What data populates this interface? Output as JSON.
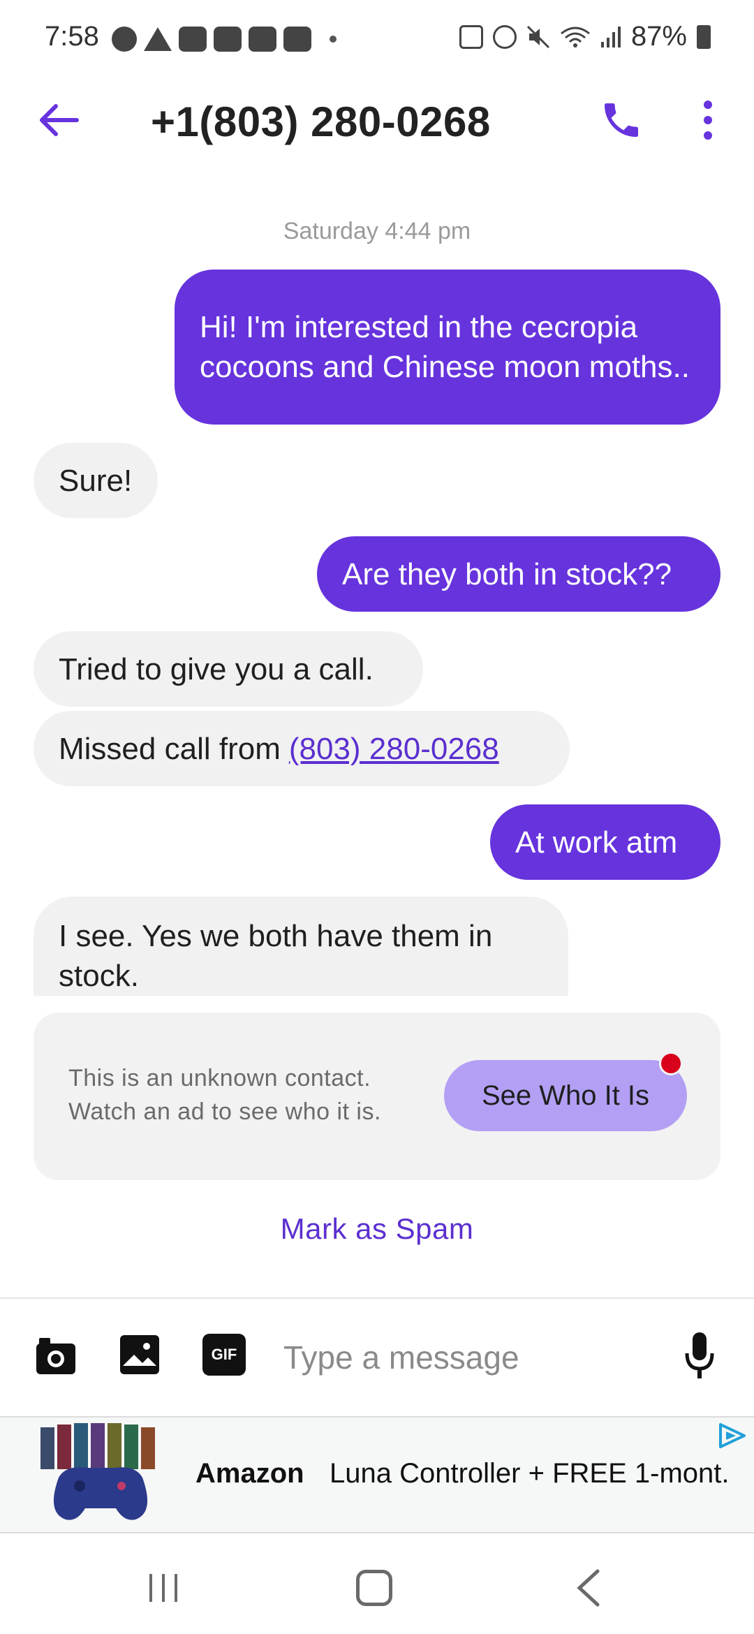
{
  "status_bar": {
    "time": "7:58",
    "battery": "87%"
  },
  "header": {
    "title": "+1(803) 280-0268",
    "back_icon": "arrow-left-icon",
    "call_icon": "phone-icon",
    "menu_icon": "more-vert-icon"
  },
  "conversation": {
    "date_stamp": "Saturday 4:44 pm",
    "messages": [
      {
        "direction": "outgoing",
        "text": "Hi! I'm interested in the cecropia cocoons and Chinese moon moths.."
      },
      {
        "direction": "incoming",
        "text": "Sure!"
      },
      {
        "direction": "outgoing",
        "text": "Are they both in stock??"
      },
      {
        "direction": "incoming",
        "text": "Tried to give you a call."
      },
      {
        "direction": "incoming",
        "text": "Missed call from",
        "link": "(803) 280-0268"
      },
      {
        "direction": "outgoing",
        "text": "At work atm"
      },
      {
        "direction": "incoming",
        "text": "I see. Yes we both have them in stock."
      }
    ]
  },
  "unknown_contact": {
    "text_line1": "This is an unknown contact.",
    "text_line2": "Watch an ad to see who it is.",
    "button_label": "See Who It Is"
  },
  "spam_link": "Mark as Spam",
  "composer": {
    "placeholder": "Type a message",
    "gif_label": "GIF"
  },
  "ad": {
    "brand": "Amazon",
    "text": "Luna Controller + FREE 1-mont..."
  },
  "colors": {
    "accent": "#6633dd",
    "incoming_bubble": "#f1f1f1",
    "see_button": "#b3a0f5",
    "notification_dot": "#d9001b"
  }
}
